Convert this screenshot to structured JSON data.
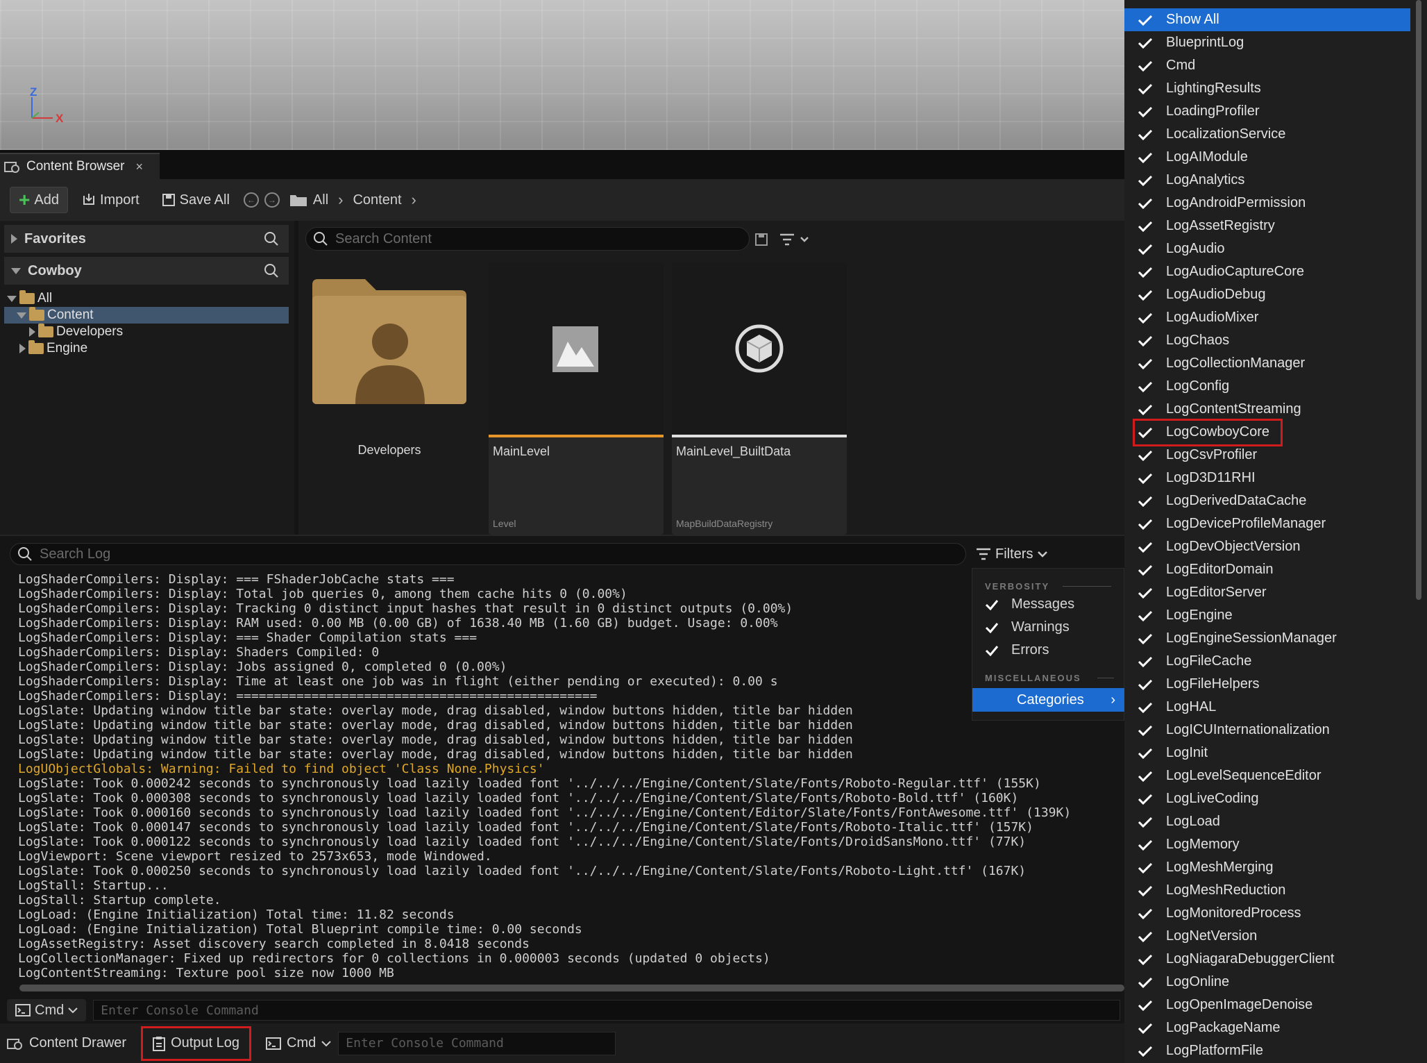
{
  "viewport": {
    "axis_z": "Z",
    "axis_x": "X"
  },
  "content_browser": {
    "tab_title": "Content Browser",
    "tab_close": "×",
    "toolbar": {
      "add": "Add",
      "import": "Import",
      "save_all": "Save All",
      "breadcrumb": [
        "All",
        "Content"
      ]
    },
    "sidebar": {
      "favorites": "Favorites",
      "project": "Cowboy",
      "tree": [
        "All",
        "Content",
        "Developers",
        "Engine"
      ]
    },
    "search_placeholder": "Search Content",
    "assets": [
      {
        "name": "Developers",
        "type": ""
      },
      {
        "name": "MainLevel",
        "type": "Level"
      },
      {
        "name": "MainLevel_BuiltData",
        "type": "MapBuildDataRegistry"
      }
    ]
  },
  "output_log": {
    "search_placeholder": "Search Log",
    "filters_label": "Filters",
    "lines": [
      "LogShaderCompilers: Display: === FShaderJobCache stats ===",
      "LogShaderCompilers: Display: Total job queries 0, among them cache hits 0 (0.00%)",
      "LogShaderCompilers: Display: Tracking 0 distinct input hashes that result in 0 distinct outputs (0.00%)",
      "LogShaderCompilers: Display: RAM used: 0.00 MB (0.00 GB) of 1638.40 MB (1.60 GB) budget. Usage: 0.00%",
      "LogShaderCompilers: Display: === Shader Compilation stats ===",
      "LogShaderCompilers: Display: Shaders Compiled: 0",
      "LogShaderCompilers: Display: Jobs assigned 0, completed 0 (0.00%)",
      "LogShaderCompilers: Display: Time at least one job was in flight (either pending or executed): 0.00 s",
      "LogShaderCompilers: Display: ================================================",
      "LogSlate: Updating window title bar state: overlay mode, drag disabled, window buttons hidden, title bar hidden",
      "LogSlate: Updating window title bar state: overlay mode, drag disabled, window buttons hidden, title bar hidden",
      "LogSlate: Updating window title bar state: overlay mode, drag disabled, window buttons hidden, title bar hidden",
      "LogSlate: Updating window title bar state: overlay mode, drag disabled, window buttons hidden, title bar hidden",
      "LogUObjectGlobals: Warning: Failed to find object 'Class None.Physics'",
      "LogSlate: Took 0.000242 seconds to synchronously load lazily loaded font '../../../Engine/Content/Slate/Fonts/Roboto-Regular.ttf' (155K)",
      "LogSlate: Took 0.000308 seconds to synchronously load lazily loaded font '../../../Engine/Content/Slate/Fonts/Roboto-Bold.ttf' (160K)",
      "LogSlate: Took 0.000160 seconds to synchronously load lazily loaded font '../../../Engine/Content/Editor/Slate/Fonts/FontAwesome.ttf' (139K)",
      "LogSlate: Took 0.000147 seconds to synchronously load lazily loaded font '../../../Engine/Content/Slate/Fonts/Roboto-Italic.ttf' (157K)",
      "LogSlate: Took 0.000122 seconds to synchronously load lazily loaded font '../../../Engine/Content/Slate/Fonts/DroidSansMono.ttf' (77K)",
      "LogViewport: Scene viewport resized to 2573x653, mode Windowed.",
      "LogSlate: Took 0.000250 seconds to synchronously load lazily loaded font '../../../Engine/Content/Slate/Fonts/Roboto-Light.ttf' (167K)",
      "LogStall: Startup...",
      "LogStall: Startup complete.",
      "LogLoad: (Engine Initialization) Total time: 11.82 seconds",
      "LogLoad: (Engine Initialization) Total Blueprint compile time: 0.00 seconds",
      "LogAssetRegistry: Asset discovery search completed in 8.0418 seconds",
      "LogCollectionManager: Fixed up redirectors for 0 collections in 0.000003 seconds (updated 0 objects)",
      "LogContentStreaming: Texture pool size now 1000 MB"
    ],
    "warning_line_index": 13,
    "cmd_label": "Cmd",
    "console_placeholder": "Enter Console Command"
  },
  "filter_menu": {
    "verbosity_header": "VERBOSITY",
    "verbosity_items": [
      "Messages",
      "Warnings",
      "Errors"
    ],
    "misc_header": "MISCELLANEOUS",
    "categories_label": "Categories"
  },
  "status_bar": {
    "content_drawer": "Content Drawer",
    "output_log": "Output Log",
    "cmd": "Cmd",
    "console_placeholder": "Enter Console Command"
  },
  "categories": {
    "show_all": "Show All",
    "items": [
      "BlueprintLog",
      "Cmd",
      "LightingResults",
      "LoadingProfiler",
      "LocalizationService",
      "LogAIModule",
      "LogAnalytics",
      "LogAndroidPermission",
      "LogAssetRegistry",
      "LogAudio",
      "LogAudioCaptureCore",
      "LogAudioDebug",
      "LogAudioMixer",
      "LogChaos",
      "LogCollectionManager",
      "LogConfig",
      "LogContentStreaming",
      "LogCowboyCore",
      "LogCsvProfiler",
      "LogD3D11RHI",
      "LogDerivedDataCache",
      "LogDeviceProfileManager",
      "LogDevObjectVersion",
      "LogEditorDomain",
      "LogEditorServer",
      "LogEngine",
      "LogEngineSessionManager",
      "LogFileCache",
      "LogFileHelpers",
      "LogHAL",
      "LogICUInternationalization",
      "LogInit",
      "LogLevelSequenceEditor",
      "LogLiveCoding",
      "LogLoad",
      "LogMemory",
      "LogMeshMerging",
      "LogMeshReduction",
      "LogMonitoredProcess",
      "LogNetVersion",
      "LogNiagaraDebuggerClient",
      "LogOnline",
      "LogOpenImageDenoise",
      "LogPackageName",
      "LogPlatformFile"
    ],
    "highlighted": "LogCowboyCore"
  },
  "colors": {
    "accent": "#1b6bd1",
    "highlight_box": "#d01c1c",
    "warning": "#e0a82b",
    "level_bar": "#e8962a",
    "data_bar": "#e0e0e0"
  }
}
